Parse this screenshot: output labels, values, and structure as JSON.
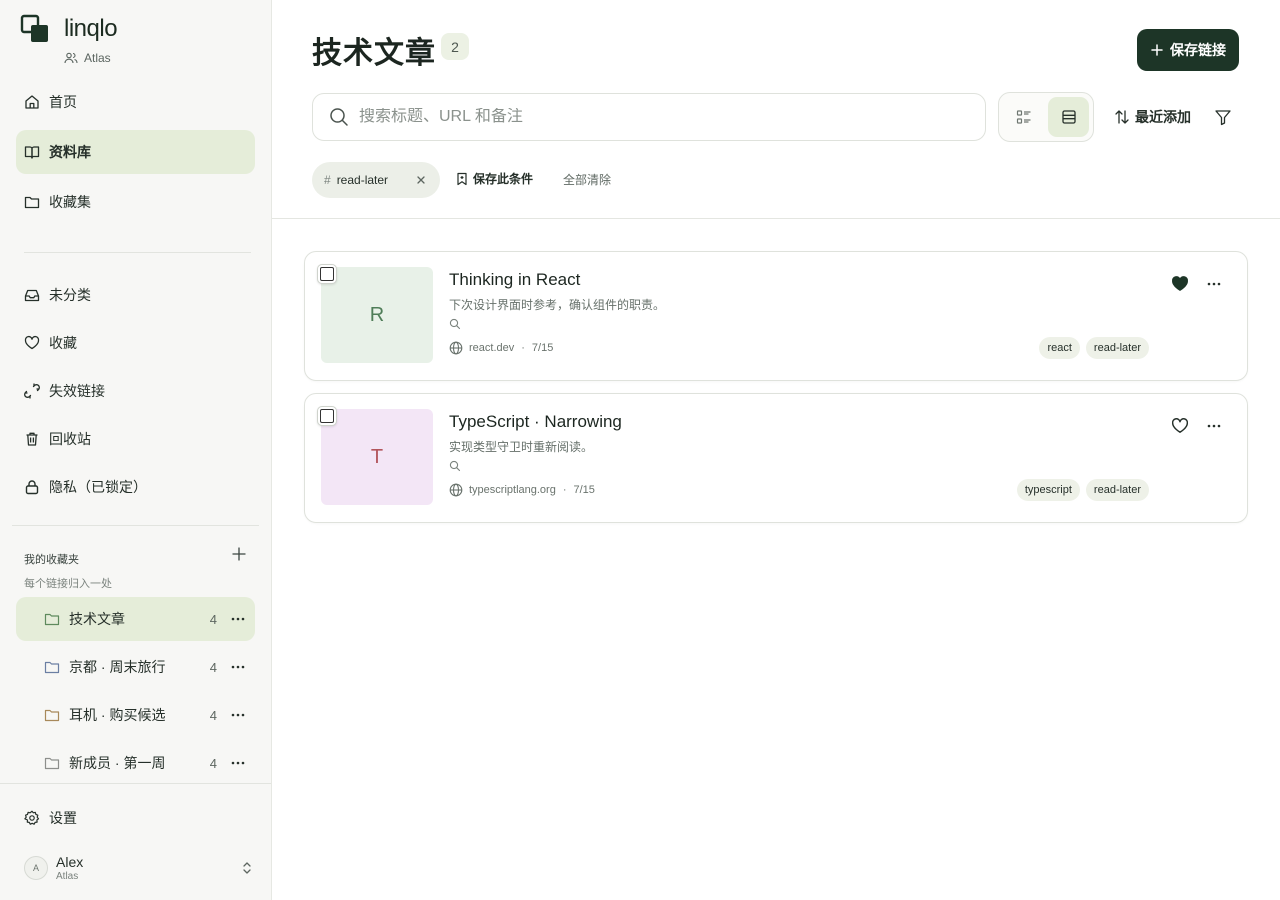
{
  "app": {
    "name": "linqlo",
    "workspace": "Atlas"
  },
  "sidebar": {
    "nav": [
      {
        "label": "首页",
        "icon": "home-icon",
        "active": false
      },
      {
        "label": "资料库",
        "icon": "book-icon",
        "active": true
      },
      {
        "label": "收藏集",
        "icon": "folder-icon",
        "active": false
      }
    ],
    "smart": [
      {
        "label": "未分类",
        "icon": "inbox-icon"
      },
      {
        "label": "收藏",
        "icon": "heart-icon"
      },
      {
        "label": "失效链接",
        "icon": "broken-link-icon"
      },
      {
        "label": "回收站",
        "icon": "trash-icon"
      },
      {
        "label": "隐私（已锁定）",
        "icon": "lock-icon"
      }
    ],
    "collections_section": {
      "title": "我的收藏夹",
      "subtitle": "每个链接归入一处",
      "items": [
        {
          "label": "技术文章",
          "count": "4",
          "active": true
        },
        {
          "label": "京都 · 周末旅行",
          "count": "4",
          "active": false
        },
        {
          "label": "耳机 · 购买候选",
          "count": "4",
          "active": false
        },
        {
          "label": "新成员 · 第一周",
          "count": "4",
          "active": false
        }
      ]
    },
    "settings_label": "设置",
    "user": {
      "avatar": "A",
      "name": "Alex",
      "workspace": "Atlas"
    }
  },
  "main": {
    "title": "技术文章",
    "count": "2",
    "save_button": "保存链接",
    "search_placeholder": "搜索标题、URL 和备注",
    "sort_label": "最近添加",
    "active_filter": {
      "hash": "#",
      "label": "read-later"
    },
    "save_condition": "保存此条件",
    "clear_all": "全部清除",
    "cards": [
      {
        "initial": "R",
        "thumb_bg": "#e8f1e8",
        "thumb_fg": "#4f7d58",
        "title": "Thinking in React",
        "note": "下次设计界面时参考，确认组件的职责。",
        "domain": "react.dev",
        "date": "7/15",
        "favorited": true,
        "tags": [
          "react",
          "read-later"
        ]
      },
      {
        "initial": "T",
        "thumb_bg": "#f3e6f6",
        "thumb_fg": "#b2555c",
        "title": "TypeScript · Narrowing",
        "note": "实现类型守卫时重新阅读。",
        "domain": "typescriptlang.org",
        "date": "7/15",
        "favorited": false,
        "tags": [
          "typescript",
          "read-later"
        ]
      }
    ]
  },
  "colors": {
    "accent": "#1d3527",
    "active_bg": "#e5edd9",
    "tag_bg": "#eef1e8"
  }
}
